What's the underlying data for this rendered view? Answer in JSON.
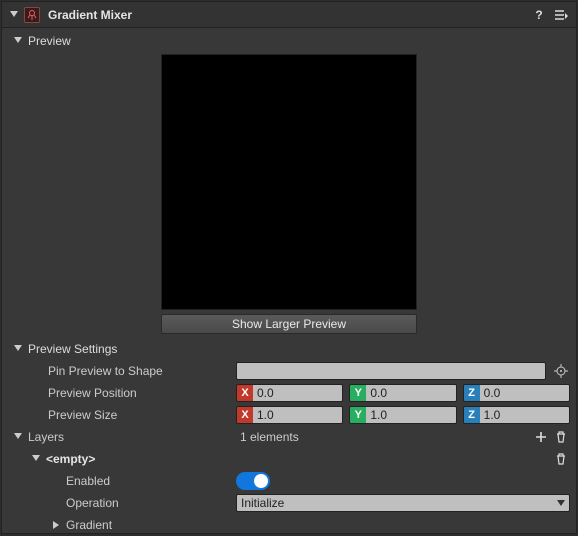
{
  "title": "Gradient Mixer",
  "sections": {
    "preview": {
      "label": "Preview"
    },
    "previewSettings": {
      "label": "Preview Settings"
    },
    "layers": {
      "label": "Layers",
      "count_text": "1 elements"
    }
  },
  "buttons": {
    "showLarger": "Show Larger Preview"
  },
  "props": {
    "pinPreviewToShape": {
      "label": "Pin Preview to Shape",
      "value": ""
    },
    "previewPosition": {
      "label": "Preview Position",
      "x": "0.0",
      "y": "0.0",
      "z": "0.0"
    },
    "previewSize": {
      "label": "Preview Size",
      "x": "1.0",
      "y": "1.0",
      "z": "1.0"
    }
  },
  "axis": {
    "x": "X",
    "y": "Y",
    "z": "Z"
  },
  "layers": [
    {
      "name": "<empty>",
      "enabled": {
        "label": "Enabled",
        "value": true
      },
      "operation": {
        "label": "Operation",
        "value": "Initialize"
      },
      "gradient": {
        "label": "Gradient"
      }
    }
  ],
  "icons": {
    "help": "?",
    "menu": "≡"
  }
}
